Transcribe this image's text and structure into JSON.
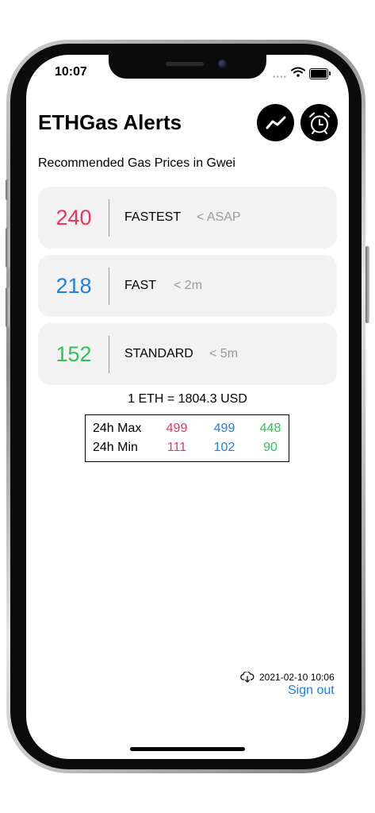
{
  "status_bar": {
    "time": "10:07",
    "signal_dots": "••••"
  },
  "header": {
    "title": "ETHGas Alerts",
    "chart_button_icon": "chart-line-icon",
    "alarm_button_icon": "alarm-clock-icon"
  },
  "subtitle": "Recommended Gas Prices in Gwei",
  "tiers": [
    {
      "price": "240",
      "label": "FASTEST",
      "eta": "< ASAP",
      "color": "#f0325a"
    },
    {
      "price": "218",
      "label": "FAST",
      "eta": "< 2m",
      "color": "#1e7fe8"
    },
    {
      "price": "152",
      "label": "STANDARD",
      "eta": "< 5m",
      "color": "#2fc15a"
    }
  ],
  "eth_rate": "1 ETH = 1804.3 USD",
  "stats": {
    "max": {
      "label": "24h Max",
      "values": [
        "499",
        "499",
        "448"
      ]
    },
    "min": {
      "label": "24h Min",
      "values": [
        "111",
        "102",
        "90"
      ]
    }
  },
  "footer": {
    "updated": "2021-02-10 10:06",
    "sign_out": "Sign out"
  }
}
